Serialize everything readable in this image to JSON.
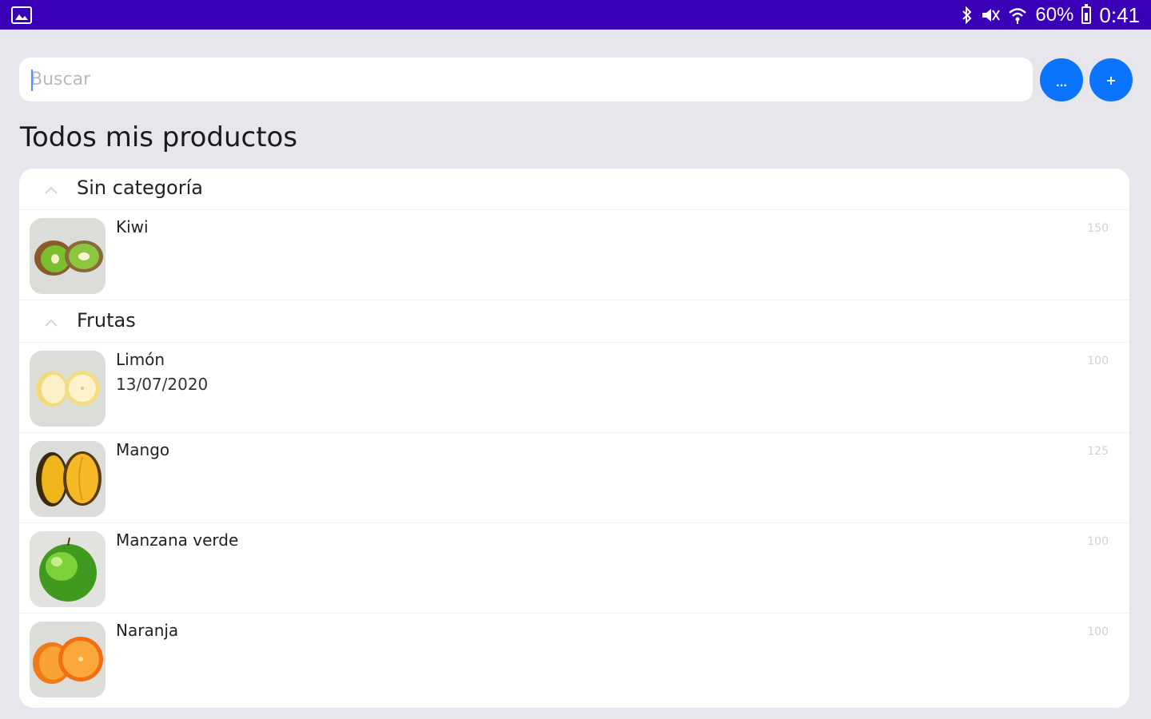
{
  "status_bar": {
    "battery": "60%",
    "time": "0:41",
    "icons": [
      "gallery-icon",
      "bluetooth-icon",
      "mute-icon",
      "wifi-icon",
      "battery-icon"
    ]
  },
  "search": {
    "placeholder": "Buscar",
    "value": ""
  },
  "actions": {
    "more_label": "...",
    "add_label": "+"
  },
  "page_title": "Todos mis productos",
  "accent_color": "#0a73ff",
  "status_bar_color": "#3a00b8",
  "categories": [
    {
      "label": "Sin categoría",
      "products": [
        {
          "name": "Kiwi",
          "date": "",
          "quantity": "150",
          "image": "kiwi"
        }
      ]
    },
    {
      "label": "Frutas",
      "products": [
        {
          "name": "Limón",
          "date": "13/07/2020",
          "quantity": "100",
          "image": "lemon"
        },
        {
          "name": "Mango",
          "date": "",
          "quantity": "125",
          "image": "mango"
        },
        {
          "name": "Manzana verde",
          "date": "",
          "quantity": "100",
          "image": "green-apple"
        },
        {
          "name": "Naranja",
          "date": "",
          "quantity": "100",
          "image": "orange"
        }
      ]
    }
  ]
}
